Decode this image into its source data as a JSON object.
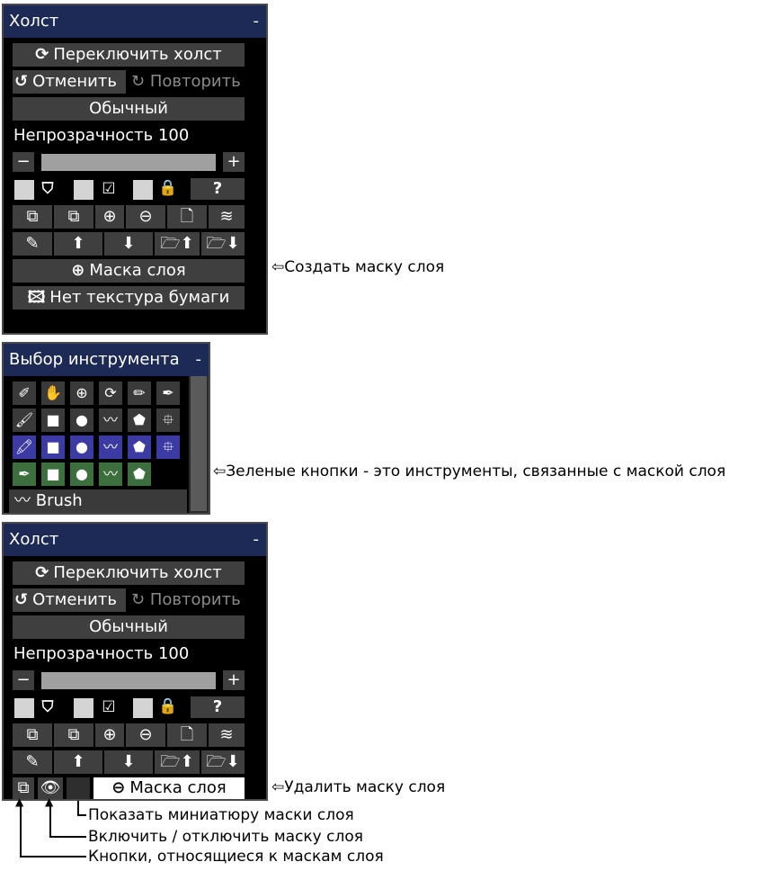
{
  "canvas1": {
    "title": "Холст",
    "collapse": "-",
    "switch_canvas": "Переключить холст",
    "undo": "Отменить",
    "redo": "Повторить",
    "blend_mode": "Обычный",
    "opacity_label": "Непрозрачность 100",
    "minus": "−",
    "plus": "+",
    "help": "?",
    "layer_mask": "Маска слоя",
    "paper_texture": "Нет текстура бумаги"
  },
  "tool_select": {
    "title": "Выбор инструмента",
    "collapse": "-",
    "current_tool": "Brush"
  },
  "canvas2": {
    "title": "Холст",
    "collapse": "-",
    "switch_canvas": "Переключить холст",
    "undo": "Отменить",
    "redo": "Повторить",
    "blend_mode": "Обычный",
    "opacity_label": "Непрозрачность 100",
    "minus": "−",
    "plus": "+",
    "help": "?",
    "layer_mask": "Маска слоя"
  },
  "annotations": {
    "create_mask": "Создать маску слоя",
    "green_buttons": "Зеленые кнопки - это инструменты, связанные с маской слоя",
    "delete_mask": "Удалить маску слоя",
    "show_thumbnail": "Показать миниатюру маски слоя",
    "toggle_mask": "Включить / отключить маску слоя",
    "mask_buttons": "Кнопки, относящиеся к маскам слоя"
  },
  "colors": {
    "panel_bg": "#000000",
    "title_bg": "#1d2a55",
    "button_bg": "#3f3f3f",
    "blue_tool": "#3b3ba3",
    "green_tool": "#3d6e3d"
  }
}
